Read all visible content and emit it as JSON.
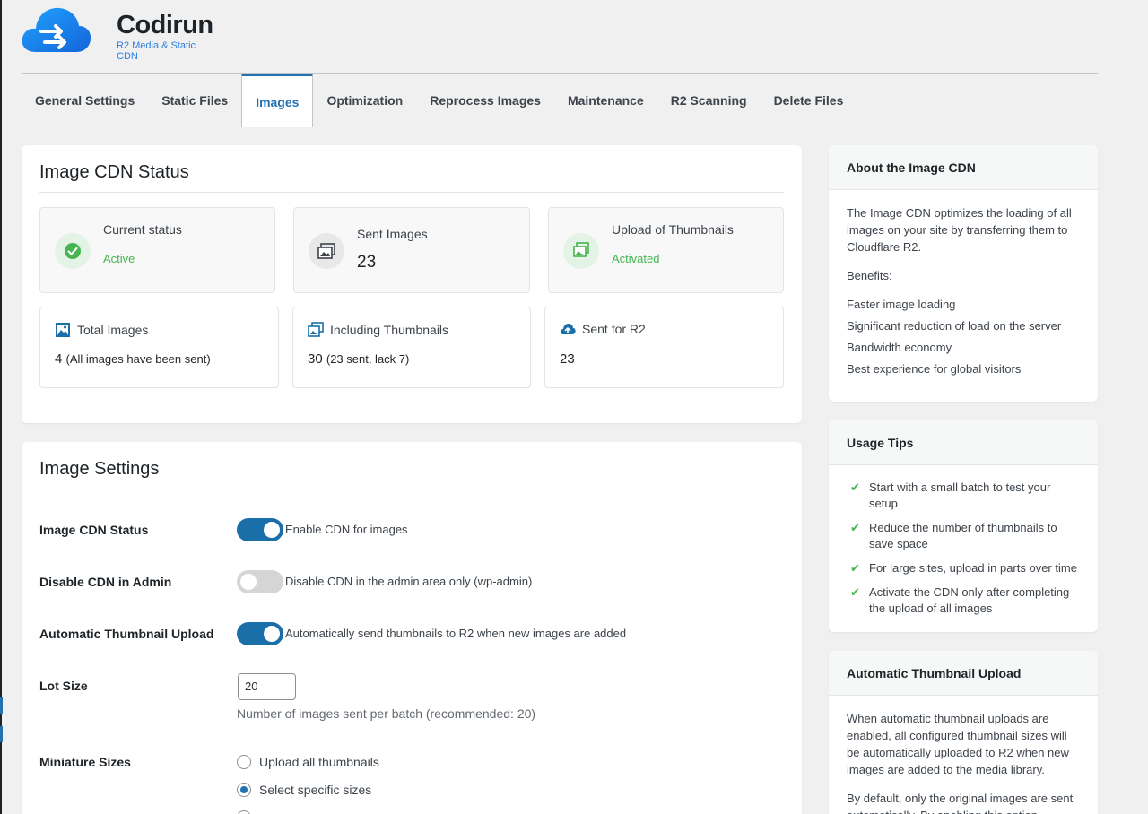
{
  "brand": {
    "name": "Codirun",
    "subtitle": "R2 Media & Static CDN",
    "accent": "#2271b1"
  },
  "tabs": [
    {
      "label": "General Settings"
    },
    {
      "label": "Static Files"
    },
    {
      "label": "Images"
    },
    {
      "label": "Optimization"
    },
    {
      "label": "Reprocess Images"
    },
    {
      "label": "Maintenance"
    },
    {
      "label": "R2 Scanning"
    },
    {
      "label": "Delete Files"
    }
  ],
  "active_tab": "Images",
  "status": {
    "title": "Image CDN Status",
    "current_status": {
      "label": "Current status",
      "value": "Active",
      "icon": "check-circle-icon"
    },
    "sent_images": {
      "label": "Sent Images",
      "value": "23",
      "icon": "images-icon"
    },
    "upload_thumbnails": {
      "label": "Upload of Thumbnails",
      "value": "Activated",
      "icon": "thumbnails-icon"
    },
    "total_images": {
      "label": "Total Images",
      "value": "4",
      "note": "(All images have been sent)",
      "icon": "image-icon"
    },
    "including_thumbnails": {
      "label": "Including Thumbnails",
      "value": "30",
      "note": "(23 sent, lack 7)",
      "icon": "gallery-icon"
    },
    "sent_r2": {
      "label": "Sent for R2",
      "value": "23",
      "icon": "cloud-upload-icon"
    }
  },
  "settings": {
    "title": "Image Settings",
    "cdn_status": {
      "label": "Image CDN Status",
      "toggle_text": "Enable CDN for images",
      "enabled": true
    },
    "disable_admin": {
      "label": "Disable CDN in Admin",
      "toggle_text": "Disable CDN in the admin area only (wp-admin)",
      "enabled": false
    },
    "auto_thumb": {
      "label": "Automatic Thumbnail Upload",
      "toggle_text": "Automatically send thumbnails to R2 when new images are added",
      "enabled": true
    },
    "lot_size": {
      "label": "Lot Size",
      "value": "20",
      "help": "Number of images sent per batch (recommended: 20)"
    },
    "miniature": {
      "label": "Miniature Sizes",
      "options": [
        {
          "label": "Upload all thumbnails",
          "checked": false
        },
        {
          "label": "Select specific sizes",
          "checked": true
        }
      ]
    }
  },
  "sidebar": {
    "about": {
      "title": "About the Image CDN",
      "intro": "The Image CDN optimizes the loading of all images on your site by transferring them to Cloudflare R2.",
      "benefits_label": "Benefits:",
      "benefits": [
        "Faster image loading",
        "Significant reduction of load on the server",
        "Bandwidth economy",
        "Best experience for global visitors"
      ]
    },
    "tips": {
      "title": "Usage Tips",
      "items": [
        "Start with a small batch to test your setup",
        "Reduce the number of thumbnails to save space",
        "For large sites, upload in parts over time",
        "Activate the CDN only after completing the upload of all images"
      ]
    },
    "auto_upload": {
      "title": "Automatic Thumbnail Upload",
      "text": "When automatic thumbnail uploads are enabled, all configured thumbnail sizes will be automatically uploaded to R2 when new images are added to the media library.",
      "text2": "By default, only the original images are sent automatically. By enabling this option,"
    }
  }
}
